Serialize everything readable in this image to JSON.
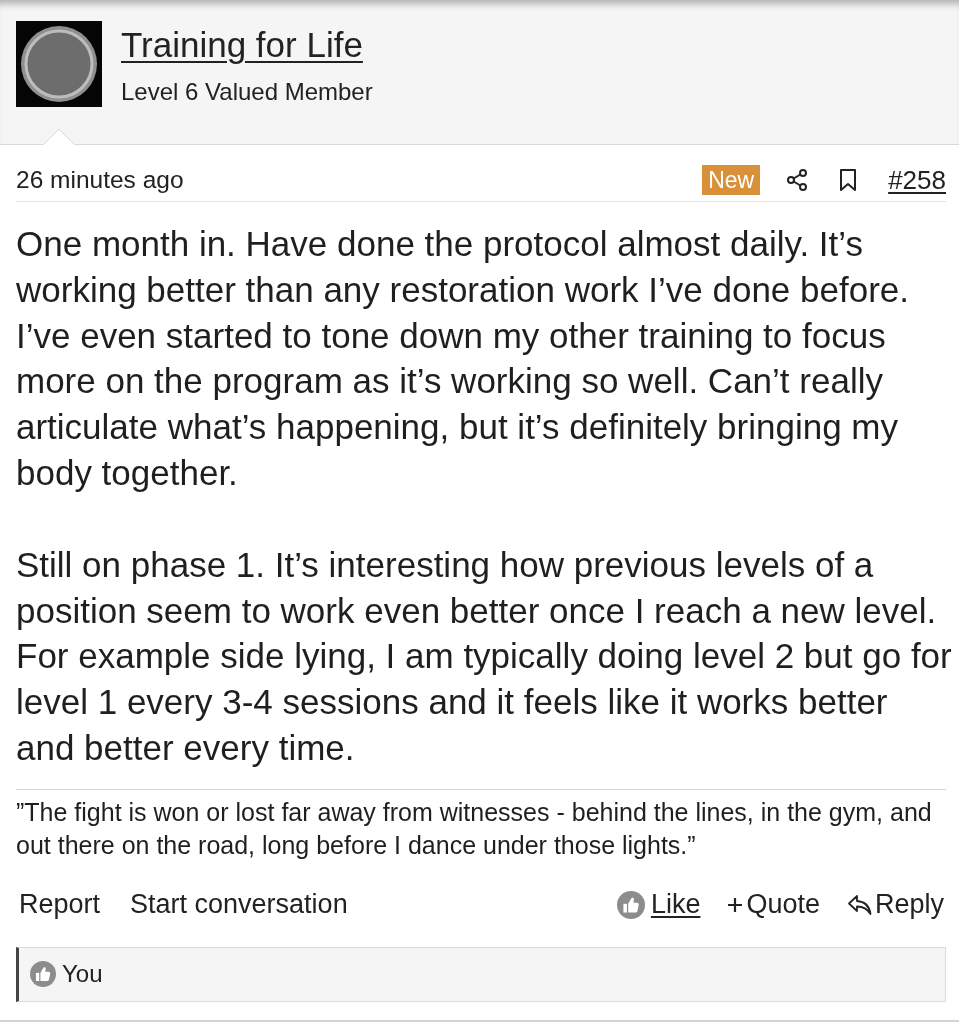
{
  "author": {
    "name": "Training for Life",
    "title": "Level 6 Valued Member"
  },
  "post": {
    "time": "26 minutes ago",
    "badge": "New",
    "number": "#258",
    "paragraphs": [
      "One month in. Have done the protocol almost daily. It’s working better than any restoration work I’ve done before. I’ve even started to tone down my other training to focus more on the program as it’s working so well. Can’t really articulate what’s happening, but it’s definitely bringing my body together.",
      "Still on phase 1. It’s interesting how previous levels of a position seem to work even better once I reach a new level. For example side lying, I am typically doing level 2 but go for level 1 every 3-4 sessions and it feels like it works better and better every time."
    ],
    "signature": "”The fight is won or lost far away from witnesses - behind the lines, in the gym, and out there on the road, long before I dance under those lights.”"
  },
  "actions": {
    "left": [
      {
        "label": "Report"
      },
      {
        "label": "Start conversation"
      }
    ],
    "right": [
      {
        "kind": "like",
        "label": "Like"
      },
      {
        "kind": "quote",
        "label": "Quote"
      },
      {
        "kind": "reply",
        "label": "Reply"
      }
    ]
  },
  "likes": {
    "names": "You"
  }
}
